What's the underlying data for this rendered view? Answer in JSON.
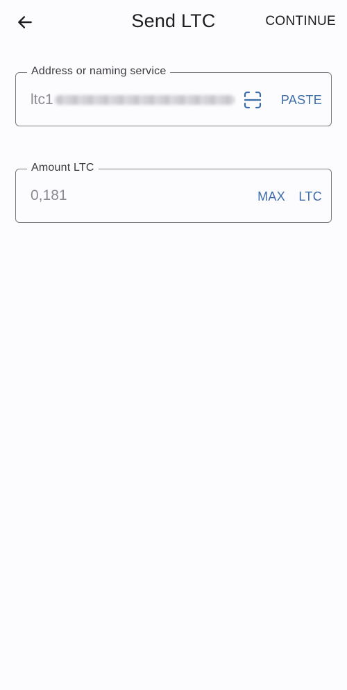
{
  "header": {
    "title": "Send LTC",
    "continue_label": "CONTINUE",
    "back_icon": "arrow-left-icon"
  },
  "address_field": {
    "label": "Address or naming service",
    "value_prefix": "ltc1",
    "scan_icon": "qr-scan-icon",
    "paste_label": "PASTE"
  },
  "amount_field": {
    "label": "Amount LTC",
    "value": "0,181",
    "max_label": "MAX",
    "unit_label": "LTC"
  },
  "colors": {
    "background": "#fcfcff",
    "accent": "#3c6ca8",
    "border": "#7a7a80"
  }
}
